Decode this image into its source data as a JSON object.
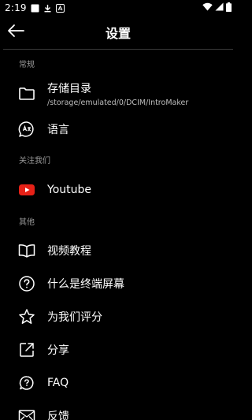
{
  "status_bar": {
    "time": "2:19"
  },
  "toolbar": {
    "title": "设置"
  },
  "sections": {
    "general": {
      "header": "常规",
      "storage": {
        "label": "存储目录",
        "path": "/storage/emulated/0/DCIM/IntroMaker"
      },
      "language": {
        "label": "语言"
      }
    },
    "follow": {
      "header": "关注我们",
      "youtube": {
        "label": "Youtube"
      }
    },
    "other": {
      "header": "其他",
      "tutorial": {
        "label": "视频教程"
      },
      "what_is": {
        "label": "什么是终端屏幕"
      },
      "rate": {
        "label": "为我们评分"
      },
      "share": {
        "label": "分享"
      },
      "faq": {
        "label": "FAQ"
      },
      "feedback": {
        "label": "反馈"
      }
    }
  },
  "colors": {
    "background": "#000000",
    "youtube_red": "#e62117",
    "section_header": "#9a9a9a"
  }
}
